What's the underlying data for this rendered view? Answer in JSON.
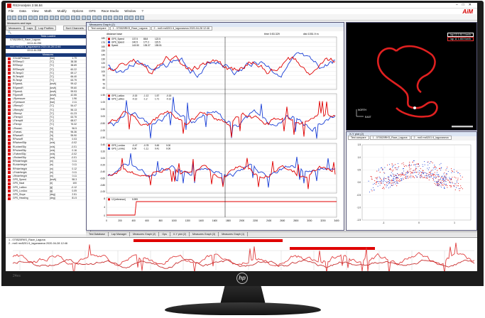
{
  "app": {
    "title": "RS2Analysis 2.56.84",
    "menu": [
      "File",
      "Data",
      "View",
      "Math",
      "Modify",
      "Options",
      "GPS",
      "Race Studio",
      "Window",
      "?"
    ],
    "brand_logo": "AiM",
    "monitor_brand": "24es"
  },
  "left_panel": {
    "header": "Measures and laps",
    "tabs": [
      "Measures",
      "Laps",
      "Lap Profiles"
    ],
    "sort_label": "Sort Channels",
    "tests_loaded_label": "Tests Loaded",
    "tests": [
      "070520RKS_Race_Laguna",
      "10:11:44.296",
      "mx5 mx5201 6_lagunaseca 2020-04-28 12:46",
      "10:11:44.208"
    ],
    "measures_label": "Measures",
    "channels": [
      {
        "name": "XXxxlePressure",
        "unit": "[bar]",
        "value": "1.79"
      },
      {
        "name": "RRTempO",
        "unit": "[°C]",
        "value": "38.38"
      },
      {
        "name": "RRTempI",
        "unit": "[°C]",
        "value": "38.69"
      },
      {
        "name": "RRTempM",
        "unit": "[°C]",
        "value": "60.22"
      },
      {
        "name": "RLTempO",
        "unit": "[°C]",
        "value": "69.17"
      },
      {
        "name": "RLTempM",
        "unit": "[°C]",
        "value": "66.40"
      },
      {
        "name": "RLTempI",
        "unit": "[°C]",
        "value": "63.79"
      },
      {
        "name": "RSpeedL",
        "unit": "[km/h]",
        "value": "99.42"
      },
      {
        "name": "RSpeedR",
        "unit": "[km/h]",
        "value": "99.60"
      },
      {
        "name": "FSpeedL",
        "unit": "[km/h]",
        "value": "99.93"
      },
      {
        "name": "FSpeedR",
        "unit": "[km/h]",
        "value": "42.55"
      },
      {
        "name": "LRpressure",
        "unit": "[bar]",
        "value": "1.96"
      },
      {
        "name": "LFpressure",
        "unit": "[bar]",
        "value": "2.11"
      },
      {
        "name": "LRtempO",
        "unit": "[°C]",
        "value": "54.47"
      },
      {
        "name": "LRtempM",
        "unit": "[°C]",
        "value": "56.13"
      },
      {
        "name": "LRtempI",
        "unit": "[°C]",
        "value": "61.23"
      },
      {
        "name": "LFtempO",
        "unit": "[°C]",
        "value": "63.75"
      },
      {
        "name": "LFtempM",
        "unit": "[°C]",
        "value": "68.07"
      },
      {
        "name": "LFtempI",
        "unit": "[°C]",
        "value": "76.32"
      },
      {
        "name": "LRwearL",
        "unit": "[%]",
        "value": "96.5"
      },
      {
        "name": "LFwearL",
        "unit": "[%]",
        "value": "96.36"
      },
      {
        "name": "RRwearR",
        "unit": "[%]",
        "value": "95.90"
      },
      {
        "name": "RFwearR",
        "unit": "[%]",
        "value": "0.03"
      },
      {
        "name": "RRwheelSlip",
        "unit": "[m/s]",
        "value": "-0.02"
      },
      {
        "name": "RLwheelSlip",
        "unit": "[m/s]",
        "value": "-0.01"
      },
      {
        "name": "RFwheelSlip",
        "unit": "[m/s]",
        "value": "0.16"
      },
      {
        "name": "LFwheelSlip",
        "unit": "[m/s]",
        "value": "-0.02"
      },
      {
        "name": "LRwheelSlip",
        "unit": "[m/s]",
        "value": "-0.01"
      },
      {
        "name": "RRrideHeight",
        "unit": "[m]",
        "value": "0.11"
      },
      {
        "name": "RLrideHeight",
        "unit": "[m]",
        "value": "0.11"
      },
      {
        "name": "RFrideHeight",
        "unit": "[m]",
        "value": "0.12"
      },
      {
        "name": "LFrideHeight",
        "unit": "[m]",
        "value": "0.11"
      },
      {
        "name": "LRrideHeight",
        "unit": "[m]",
        "value": "0.11"
      },
      {
        "name": "GPS_Speed",
        "unit": "[km/h]",
        "value": "98.3"
      },
      {
        "name": "GPS_Nsat",
        "unit": "[#]",
        "value": "100"
      },
      {
        "name": "GPS_LatAcc",
        "unit": "[g]",
        "value": "-0.12"
      },
      {
        "name": "GPS_LonAcc",
        "unit": "[g]",
        "value": "0.09"
      },
      {
        "name": "GPS_Slope",
        "unit": "[deg]",
        "value": "2.51"
      },
      {
        "name": "GPS_Heading",
        "unit": "[deg]",
        "value": "81.5"
      }
    ]
  },
  "graph_window": {
    "title": "Measures Graph (2)",
    "tabs": [
      "Test compare",
      "1 - 070520RKS_Race_Laguna",
      "2 - mx5 mx5201 6_lagunaseca 2020-04-28 12:46"
    ],
    "distance_label": "distance base",
    "time_label": "time 0:53.329",
    "dist_label": "dist 1051.9 m",
    "colors": {
      "test1": "#e00000",
      "test2": "#1a3fd6"
    },
    "panels": [
      {
        "legend": [
          {
            "name": "GPS_Speed",
            "v1": "137.5",
            "v2": "88.8",
            "v3": "122.5"
          },
          {
            "name": "GPS_Speed",
            "v1": "140.5",
            "v2": "177.2",
            "v3": "115.5"
          },
          {
            "name": "Speed",
            "v1": "143.50",
            "v2": "135.37",
            "v3": "155.51"
          }
        ],
        "yticks": [
          "180",
          "170",
          "160",
          "150",
          "140",
          "130",
          "120",
          "110",
          "100",
          "90",
          "80",
          "70",
          "60"
        ]
      },
      {
        "legend": [
          {
            "name": "GPS_LatAcc",
            "v1": "-0.15",
            "v2": "-1.12",
            "v3": "1.57",
            "v4": "-0.15"
          },
          {
            "name": "GPS_LatAcc",
            "v1": "-0.12",
            "v2": "-1.2",
            "v3": "1.71",
            "v4": "-0.12"
          }
        ],
        "yticks": [
          "1.50",
          "1.00",
          "0.50",
          "0.00",
          "-0.50",
          "-1.00",
          "-1.50"
        ]
      },
      {
        "legend": [
          {
            "name": "GPS_LonAcc",
            "v1": "-0.47",
            "v2": "-0.78",
            "v3": "0.45",
            "v4": "0.00"
          },
          {
            "name": "GPS_LonAcc",
            "v1": "0.09",
            "v2": "-1.11",
            "v3": "0.41",
            "v4": "0.00"
          }
        ],
        "yticks": [
          "0.40",
          "0.20",
          "0.00",
          "-0.20",
          "-0.40",
          "-0.60",
          "-0.80",
          "-1.00"
        ]
      },
      {
        "legend": [
          {
            "name": "12 [reference]",
            "v1": "5.999"
          }
        ],
        "yticks": [
          "8",
          "4",
          "0"
        ]
      }
    ],
    "xticks": [
      "0",
      "200",
      "400",
      "600",
      "800",
      "1000",
      "1200",
      "1400",
      "1600",
      "1800",
      "2000",
      "2200",
      "2400",
      "2600",
      "2800",
      "3000",
      "3200",
      "3400"
    ]
  },
  "track_window": {
    "lap_labels": [
      "lap 13 1:51.1 km/h",
      "lap 11 1:48.9 km/h"
    ],
    "north_label": "NORTH",
    "east_label": "EAST"
  },
  "xy_window": {
    "title": "X-Y plot (2)",
    "tabs": [
      "Test compare",
      "1 - 070520RKS_Race_Laguna",
      "2 - mx5 mx5201 6_lagunaseca"
    ],
    "xticks": [
      "-1",
      "0",
      "1"
    ],
    "yticks": [
      "1.5",
      "1.0",
      "0.5",
      "0.0",
      "-0.5",
      "-1.0",
      "-1.5"
    ]
  },
  "status_tabs": [
    "Test Database",
    "Lap Manager",
    "Measures Graph (2)",
    "Gps",
    "X-Y plot (2)",
    "Measures Graph (3)",
    "Measures Graph (1)"
  ],
  "bottom_strip": {
    "label": "1 - 070520RKS_Race_Laguna",
    "label2": "2 - mx5 mx5201 6_lagunaseca 2020-04-28 12:46"
  }
}
